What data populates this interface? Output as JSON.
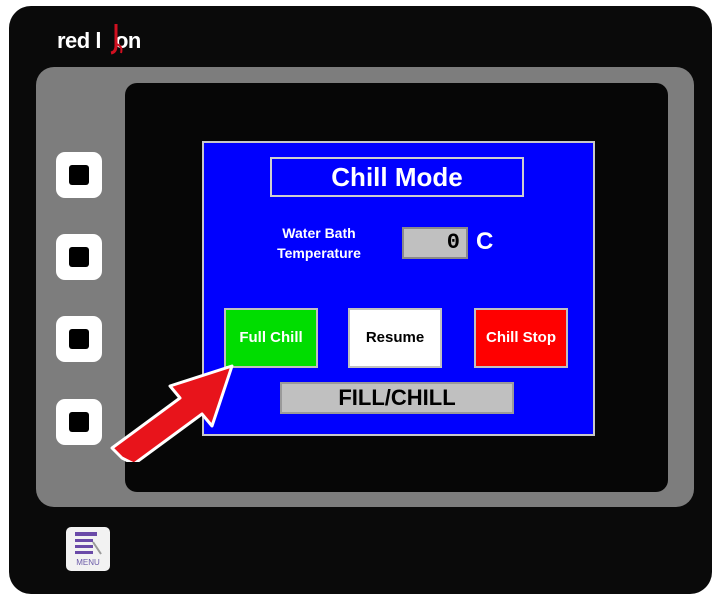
{
  "brand": {
    "logo_text": "red lion"
  },
  "screen": {
    "title": "Chill Mode",
    "temperature": {
      "label_line1": "Water Bath",
      "label_line2": "Temperature",
      "value": "0",
      "unit": "C"
    },
    "buttons": {
      "full_chill": "Full Chill",
      "resume": "Resume",
      "chill_stop": "Chill Stop"
    },
    "status": "FILL/CHILL"
  },
  "menu": {
    "label": "MENU"
  },
  "colors": {
    "screen_background": "#0000fe",
    "full_chill_button": "#00dd00",
    "resume_button": "#ffffff",
    "chill_stop_button": "#ff0000",
    "arrow": "#e8141b"
  },
  "icons": {
    "arrow": "red-arrow-icon",
    "menu": "menu-list-icon"
  }
}
